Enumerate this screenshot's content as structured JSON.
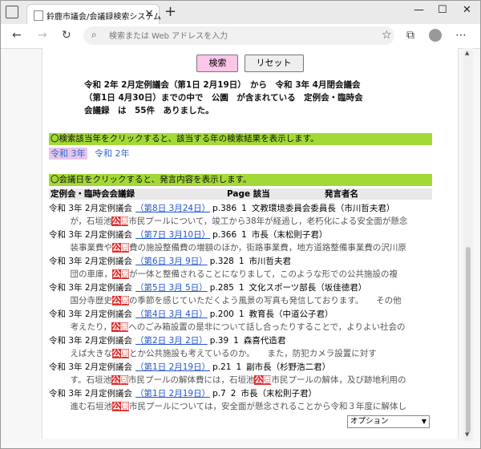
{
  "browser": {
    "tab_title": "鈴鹿市議会/会議録検索システム",
    "address_placeholder": "検索または Web アドレスを入力"
  },
  "buttons": {
    "search": "検索",
    "reset": "リセット"
  },
  "summary": {
    "line1": "令和 2年 2月定例議会（第1日 2月19日）　から　令和 3年 4月閉会議会",
    "line2": "（第1日 4月30日）までの中で　公園　が含まれている　定例会・臨時会",
    "line3": "会議録　は　55件　ありました。"
  },
  "year_notice": "〇検索該当年をクリックすると、該当する年の検索結果を表示します。",
  "years": [
    "令和 3年",
    "令和 2年"
  ],
  "meeting_notice": "〇会議日をクリックすると、発言内容を表示します。",
  "table_header": {
    "col1": "定例会・臨時会会議録",
    "col2": "Page 該当",
    "col3": "発言者名"
  },
  "keyword": "公園",
  "records": [
    {
      "meeting": "令和 3年 2月定例議会",
      "date": "（第8日 3月24日）",
      "page": "p.386",
      "count": "1",
      "speaker": "文教環境委員会委員長（市川哲夫君）",
      "pre": "　が，石垣池",
      "post": "市民プールについて，竣工から38年が経過し，老朽化による安全面が懸念"
    },
    {
      "meeting": "令和 3年 2月定例議会",
      "date": "（第7日 3月10日）",
      "page": "p.366",
      "count": "1",
      "speaker": "市長（末松則子君）",
      "pre": "　装事業費や",
      "post": "費の施設整備費の増額のほか，街路事業費，地方道路整備事業費の沢川原"
    },
    {
      "meeting": "令和 3年 2月定例議会",
      "date": "（第6日 3月 9日）",
      "page": "p.328",
      "count": "1",
      "speaker": "市川哲夫君",
      "pre": "　団の車庫，",
      "post": "が一体と整備されることになりまして，このような形での公共施設の複"
    },
    {
      "meeting": "令和 3年 2月定例議会",
      "date": "（第5日 3月 5日）",
      "page": "p.285",
      "count": "1",
      "speaker": "文化スポーツ部長（坂佳徳君）",
      "pre": "　国分寺歴史",
      "post": "の季節を感じていただくよう風景の写真も発信しております。　　その他"
    },
    {
      "meeting": "令和 3年 2月定例議会",
      "date": "（第4日 3月 4日）",
      "page": "p.200",
      "count": "1",
      "speaker": "教育長（中道公子君）",
      "pre": "　考えたり，",
      "post": "へのごみ箱設置の是非について話し合ったりすることで，よりよい社会の"
    },
    {
      "meeting": "令和 3年 2月定例議会",
      "date": "（第2日 3月 2日）",
      "page": "p.39",
      "count": "1",
      "speaker": "森喜代造君",
      "pre": "　えば大きな",
      "post": "とか公共施設も考えているのか。　　また，防犯カメラ設置に対す"
    },
    {
      "meeting": "令和 3年 2月定例議会",
      "date": "（第1日 2月19日）",
      "page": "p.21",
      "count": "1",
      "speaker": "副市長（杉野浩二君）",
      "pre": "　す。石垣池",
      "post": "市民プールの解体費には，石垣池",
      "post2": "市民プールの解体，及び跡地利用の"
    },
    {
      "meeting": "令和 3年 2月定例議会",
      "date": "（第1日 2月19日）",
      "page": "p.7",
      "count": "2",
      "speaker": "市長（末松則子君）",
      "pre": "　進む石垣池",
      "post": "市民プールについては，安全面が懸念されることから令和３年度に解体し"
    }
  ],
  "option_select": "オプション"
}
